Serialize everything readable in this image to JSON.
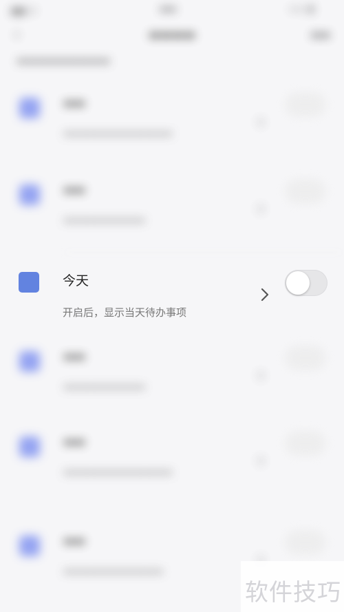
{
  "focused_item": {
    "label": "今天",
    "description": "开启后，显示当天待办事项",
    "toggle_on": false,
    "icon_color": "#6283e0"
  },
  "watermark": "软件技巧",
  "accent_color": "#6283e0"
}
